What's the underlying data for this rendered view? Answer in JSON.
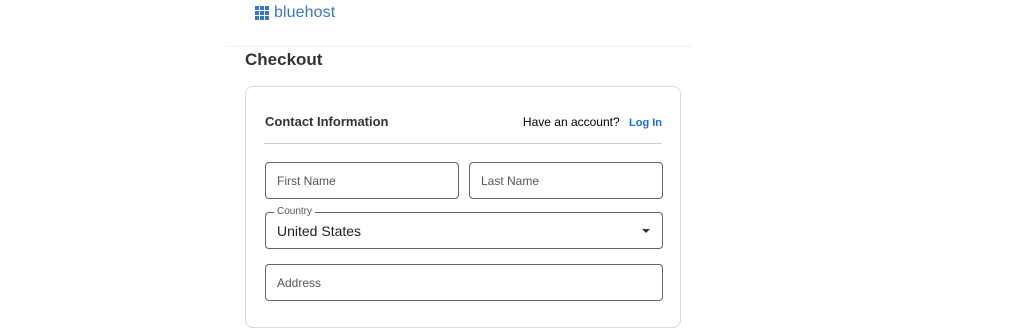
{
  "brand": {
    "name": "bluehost",
    "color": "#3575d3"
  },
  "page": {
    "title": "Checkout"
  },
  "contact": {
    "section_title": "Contact Information",
    "account_prompt": "Have an account?",
    "login_label": "Log In",
    "first_name": {
      "placeholder": "First Name",
      "value": ""
    },
    "last_name": {
      "placeholder": "Last Name",
      "value": ""
    },
    "country": {
      "label": "Country",
      "selected": "United States"
    },
    "address": {
      "placeholder": "Address",
      "value": ""
    }
  },
  "colors": {
    "link": "#196bde",
    "border": "#666666",
    "divider": "#cccccc"
  }
}
